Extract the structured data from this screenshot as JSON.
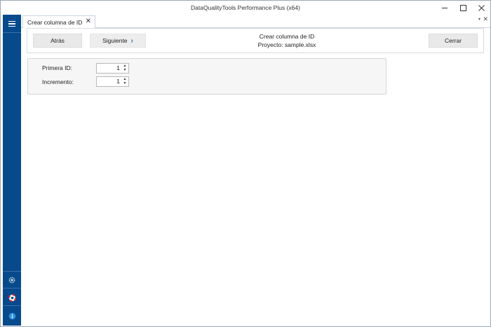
{
  "window": {
    "title": "DataQualityTools Performance Plus (x64)",
    "accent_color": "#064a8c"
  },
  "sidebar": {
    "icons": [
      "menu-icon",
      "settings-icon",
      "help-lifebuoy-icon",
      "info-icon"
    ]
  },
  "tabs": [
    {
      "label": "Crear columna de ID",
      "close": "✕"
    }
  ],
  "tabstrip": {
    "dropdown": "▾",
    "close": "✕"
  },
  "toolbar": {
    "back_label": "Atrás",
    "next_label": "Siguiente",
    "next_chevron": "›",
    "close_label": "Cerrar",
    "heading": "Crear columna de ID",
    "project": "Proyecto: sample.xlsx"
  },
  "form": {
    "first_id": {
      "label": "Primera ID:",
      "value": "1"
    },
    "increment": {
      "label": "Incremento:",
      "value": "1"
    },
    "spin_up": "▲",
    "spin_down": "▼"
  }
}
